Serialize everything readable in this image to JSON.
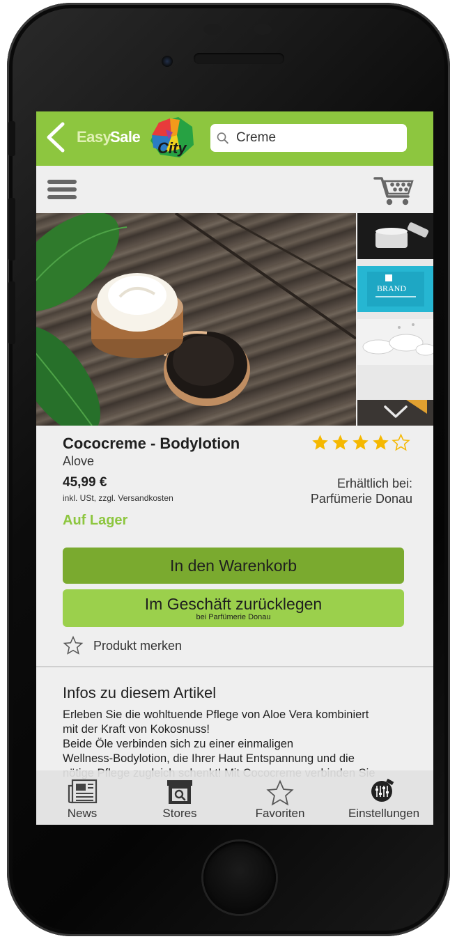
{
  "header": {
    "back_icon": "chevron-left-icon",
    "logo": {
      "easy": "Easy",
      "sale": "Sale",
      "city": "City"
    },
    "search": {
      "value": "Creme",
      "icon": "search-icon"
    }
  },
  "toolbar": {
    "menu_icon": "hamburger-menu-icon",
    "cart_icon": "shopping-cart-icon"
  },
  "gallery": {
    "thumbnails": [
      {
        "brand_text": "BRAND"
      }
    ]
  },
  "product": {
    "title": "Cococreme - Bodylotion",
    "brand": "Alove",
    "rating": 4,
    "rating_max": 5,
    "price": "45,99 €",
    "price_note": "inkl. USt, zzgl. Versandkosten",
    "available_label": "Erhältlich bei:",
    "available_store": "Parfümerie Donau",
    "stock_status": "Auf Lager"
  },
  "actions": {
    "add_to_cart": "In den Warenkorb",
    "reserve": "Im Geschäft zurücklegen",
    "reserve_sub": "bei Parfümerie Donau",
    "wishlist": "Produkt merken"
  },
  "info": {
    "heading": "Infos zu diesem Artikel",
    "lines": [
      "Erleben Sie die wohltuende Pflege von Aloe Vera kombiniert",
      "mit der Kraft von Kokosnuss!",
      "Beide Öle verbinden sich zu einer einmaligen",
      "Wellness-Bodylotion, die Ihrer Haut Entspannung und die",
      "nötige Pflege zugleich schenkt! Mit Cococreme verbinden Sie"
    ]
  },
  "tabs": [
    {
      "label": "News",
      "icon": "newspaper-icon"
    },
    {
      "label": "Stores",
      "icon": "store-icon"
    },
    {
      "label": "Favoriten",
      "icon": "star-outline-icon"
    },
    {
      "label": "Einstellungen",
      "icon": "settings-sliders-icon"
    }
  ],
  "colors": {
    "brand_green": "#8dc63f",
    "button_dark_green": "#7aaa2f",
    "button_light_green": "#9bd04c",
    "star_gold": "#f5b800"
  }
}
